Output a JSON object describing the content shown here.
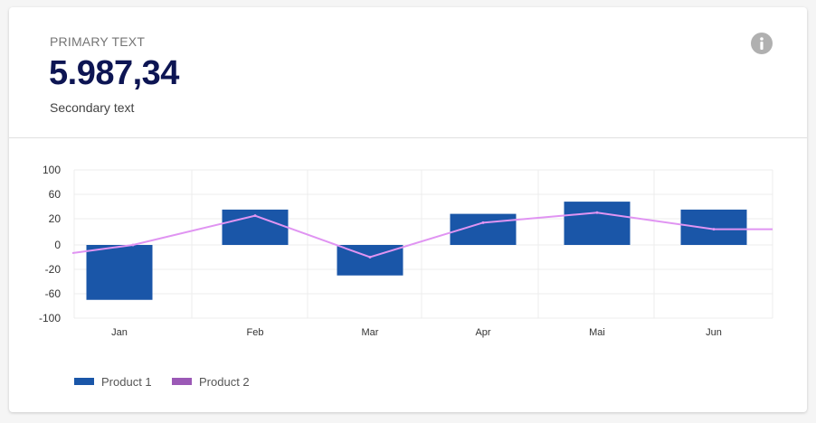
{
  "header": {
    "primary_text": "PRIMARY TEXT",
    "value": "5.987,34",
    "secondary_text": "Secondary text",
    "info_icon": "info-icon"
  },
  "chart_data": {
    "type": "bar",
    "categories": [
      "Jan",
      "Feb",
      "Mar",
      "Apr",
      "Mai",
      "Jun"
    ],
    "y_ticks": [
      {
        "label": "100",
        "value": 100
      },
      {
        "label": "60",
        "value": 60
      },
      {
        "label": "20",
        "value": 20
      },
      {
        "label": "0",
        "value": 0
      },
      {
        "label": "-20",
        "value": -20
      },
      {
        "label": "-60",
        "value": -60
      },
      {
        "label": "-100",
        "value": -100
      }
    ],
    "ylim": [
      -100,
      100
    ],
    "grid": true,
    "legend_position": "bottom-left",
    "series": [
      {
        "name": "Product 1",
        "type": "bar",
        "color": "#1a56a8",
        "values": [
          -70,
          35,
          -30,
          28,
          48,
          35
        ]
      },
      {
        "name": "Product 2",
        "type": "line",
        "color": "#9b59b6",
        "line_color": "#e094f2",
        "values": [
          0,
          25,
          -10,
          17,
          30,
          12
        ]
      }
    ]
  }
}
